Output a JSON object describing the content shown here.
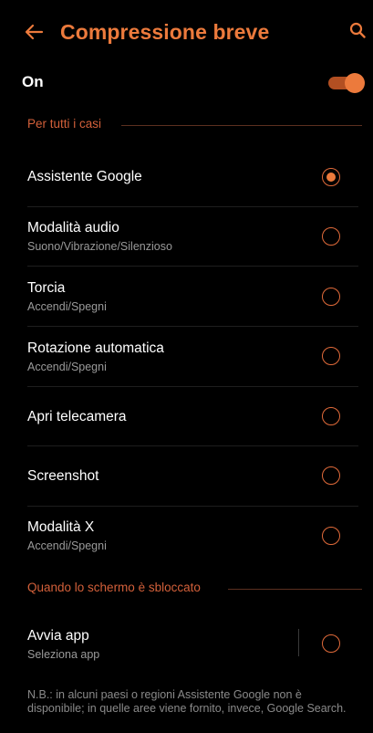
{
  "header": {
    "title": "Compressione breve",
    "back_icon": "arrow-left-icon",
    "search_icon": "search-icon"
  },
  "master": {
    "label": "On",
    "enabled": true
  },
  "sections": [
    {
      "title": "Per tutti i casi",
      "items": [
        {
          "title": "Assistente Google",
          "subtitle": "",
          "selected": true
        },
        {
          "title": "Modalità audio",
          "subtitle": "Suono/Vibrazione/Silenzioso",
          "selected": false
        },
        {
          "title": "Torcia",
          "subtitle": "Accendi/Spegni",
          "selected": false
        },
        {
          "title": "Rotazione automatica",
          "subtitle": "Accendi/Spegni",
          "selected": false
        },
        {
          "title": "Apri telecamera",
          "subtitle": "",
          "selected": false
        },
        {
          "title": "Screenshot",
          "subtitle": "",
          "selected": false
        },
        {
          "title": "Modalità X",
          "subtitle": "Accendi/Spegni",
          "selected": false
        }
      ]
    },
    {
      "title": "Quando lo schermo è sbloccato",
      "items": [
        {
          "title": "Avvia app",
          "subtitle": "Seleziona app",
          "selected": false
        }
      ]
    }
  ],
  "footnote": "N.B.: in alcuni paesi o regioni Assistente Google non è disponibile; in quelle aree viene fornito, invece, Google Search.",
  "colors": {
    "accent": "#ec7a3c",
    "section_header": "#d3603a",
    "background": "#000000",
    "secondary_text": "#9a9a9a"
  }
}
